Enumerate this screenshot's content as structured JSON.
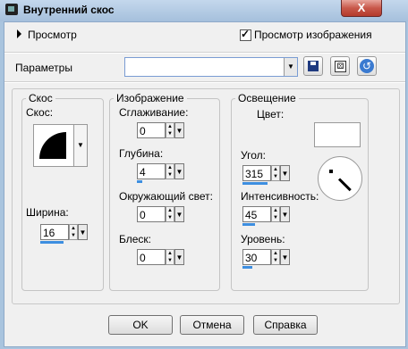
{
  "window": {
    "title": "Внутренний скос",
    "close_glyph": "X",
    "title_icon": "app-icon"
  },
  "preview": {
    "toggle_label": "Просмотр",
    "show_preview_label": "Просмотр изображения",
    "show_preview_checked": true
  },
  "params": {
    "label": "Параметры",
    "value": "",
    "icons": [
      "save-icon",
      "random-dice-icon",
      "reset-icon"
    ]
  },
  "bevel": {
    "group_title": "Скос",
    "shape_label": "Скос:",
    "width_label": "Ширина:",
    "width_value": "16",
    "width_fill": 0.8
  },
  "image": {
    "group_title": "Изображение",
    "smoothing_label": "Сглаживание:",
    "smoothing_value": "0",
    "smoothing_fill": 0.0,
    "depth_label": "Глубина:",
    "depth_value": "4",
    "depth_fill": 0.2,
    "ambience_label": "Окружающий свет:",
    "ambience_value": "0",
    "ambience_fill": 0.0,
    "shininess_label": "Блеск:",
    "shininess_value": "0",
    "shininess_fill": 0.0
  },
  "lighting": {
    "group_title": "Освещение",
    "color_label": "Цвет:",
    "color_value": "#ffffff",
    "angle_label": "Угол:",
    "angle_value": "315",
    "angle_fill": 0.87,
    "intensity_label": "Интенсивность:",
    "intensity_value": "45",
    "intensity_fill": 0.45,
    "elevation_label": "Уровень:",
    "elevation_value": "30",
    "elevation_fill": 0.33
  },
  "buttons": {
    "ok": "OK",
    "cancel": "Отмена",
    "help": "Справка"
  },
  "colors": {
    "accent": "#3d8ee0",
    "close_button": "#c8584a"
  }
}
